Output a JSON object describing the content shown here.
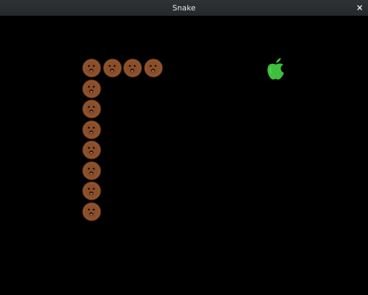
{
  "window": {
    "title": "Snake",
    "close_glyph": "×"
  },
  "game": {
    "snake_color": "#8a4f2a",
    "apple_color": "#3fbf3a",
    "snake": [
      {
        "col": 0,
        "row": 0
      },
      {
        "col": 1,
        "row": 0
      },
      {
        "col": 2,
        "row": 0
      },
      {
        "col": 3,
        "row": 0
      },
      {
        "col": 0,
        "row": 1
      },
      {
        "col": 0,
        "row": 2
      },
      {
        "col": 0,
        "row": 3
      },
      {
        "col": 0,
        "row": 4
      },
      {
        "col": 0,
        "row": 5
      },
      {
        "col": 0,
        "row": 6
      },
      {
        "col": 0,
        "row": 7
      }
    ],
    "icons": {
      "segment": "snake-face-icon",
      "food": "apple-icon"
    }
  }
}
